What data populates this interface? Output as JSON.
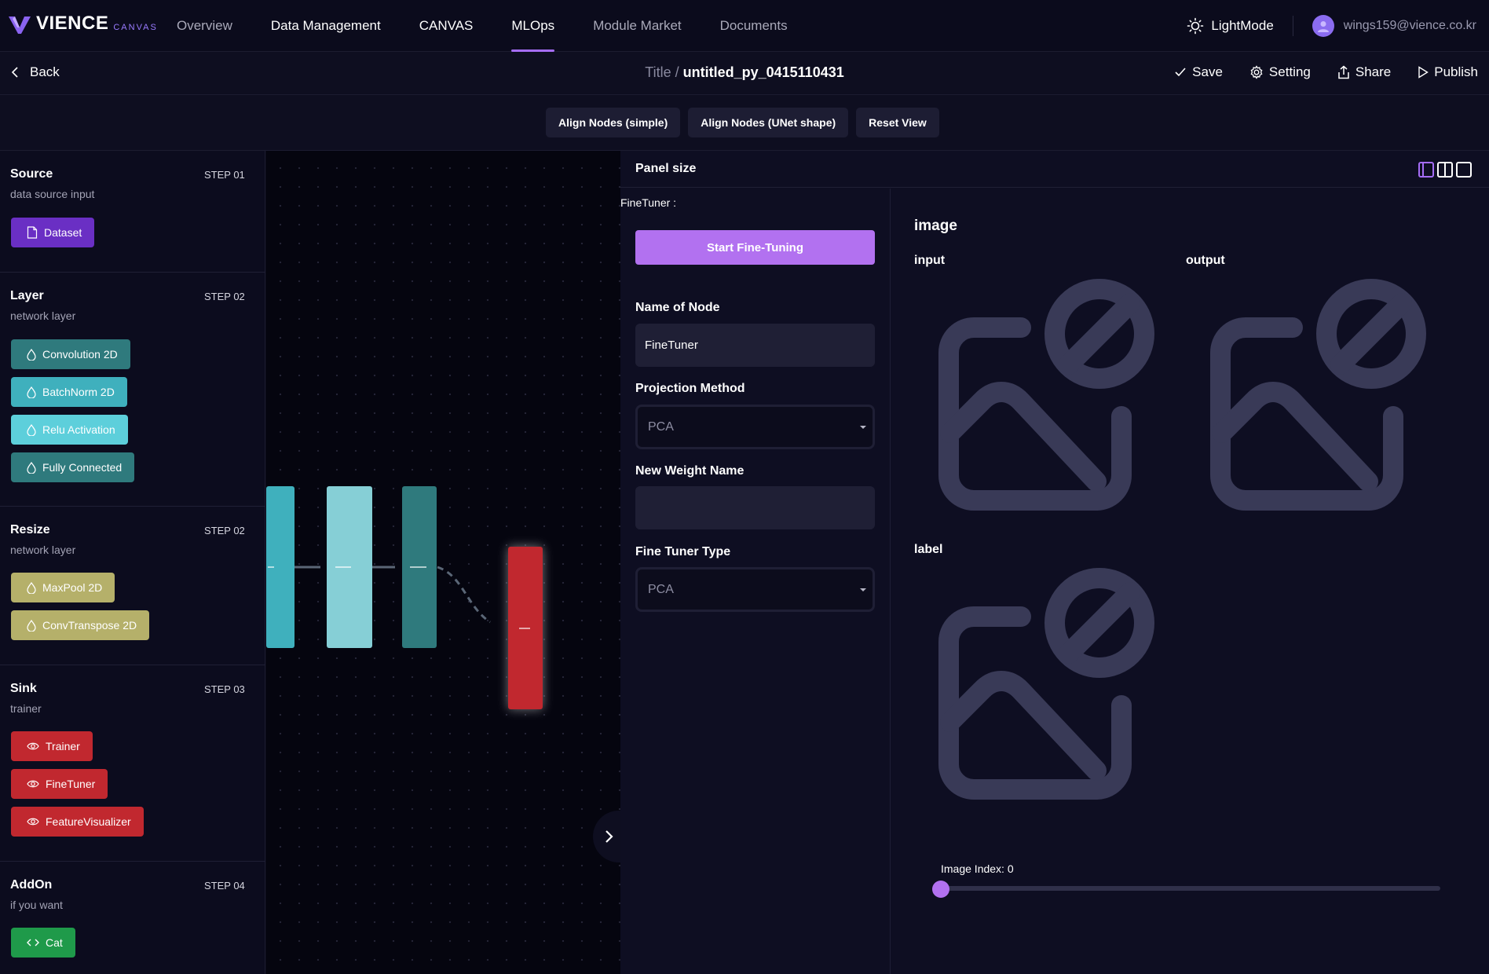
{
  "brand": {
    "name": "VIENCE",
    "sub": "CANVAS"
  },
  "nav": {
    "tabs": [
      "Overview",
      "Data Management",
      "CANVAS",
      "MLOps",
      "Module Market",
      "Documents"
    ],
    "active": "MLOps",
    "lightmode": "LightMode",
    "user_email": "wings159@vience.co.kr"
  },
  "titlebar": {
    "back": "Back",
    "title_prefix": "Title /",
    "title": "untitled_py_0415110431",
    "actions": {
      "save": "Save",
      "setting": "Setting",
      "share": "Share",
      "publish": "Publish"
    }
  },
  "toolbar": {
    "align_simple": "Align Nodes (simple)",
    "align_unet": "Align Nodes (UNet shape)",
    "reset_view": "Reset View"
  },
  "sidebar": {
    "sections": [
      {
        "title": "Source",
        "step": "STEP 01",
        "sub": "data source input",
        "items": [
          {
            "label": "Dataset",
            "icon": "file-icon",
            "color": "#6a2fc4"
          }
        ]
      },
      {
        "title": "Layer",
        "step": "STEP 02",
        "sub": "network layer",
        "items": [
          {
            "label": "Convolution 2D",
            "icon": "drop-icon",
            "color": "#2f7a7d"
          },
          {
            "label": "BatchNorm 2D",
            "icon": "drop-icon",
            "color": "#3fb0bd"
          },
          {
            "label": "Relu Activation",
            "icon": "drop-icon",
            "color": "#5dcfdb"
          },
          {
            "label": "Fully Connected",
            "icon": "drop-icon",
            "color": "#2f7a7d"
          }
        ]
      },
      {
        "title": "Resize",
        "step": "STEP 02",
        "sub": "network layer",
        "items": [
          {
            "label": "MaxPool 2D",
            "icon": "drop-icon",
            "color": "#b5b06a"
          },
          {
            "label": "ConvTranspose 2D",
            "icon": "drop-icon",
            "color": "#b5b06a"
          }
        ]
      },
      {
        "title": "Sink",
        "step": "STEP 03",
        "sub": "trainer",
        "items": [
          {
            "label": "Trainer",
            "icon": "eye-icon",
            "color": "#c1282f"
          },
          {
            "label": "FineTuner",
            "icon": "eye-icon",
            "color": "#c1282f"
          },
          {
            "label": "FeatureVisualizer",
            "icon": "eye-icon",
            "color": "#c1282f"
          }
        ]
      },
      {
        "title": "AddOn",
        "step": "STEP 04",
        "sub": "if you want",
        "items": [
          {
            "label": "Cat",
            "icon": "code-icon",
            "color": "#1f9a4a"
          }
        ]
      }
    ]
  },
  "panel": {
    "title": "Panel size",
    "finetuner_label": "FineTuner :",
    "start_button": "Start Fine-Tuning",
    "fields": {
      "name_label": "Name of Node",
      "name_value": "FineTuner",
      "projection_label": "Projection Method",
      "projection_value": "PCA",
      "weight_label": "New Weight Name",
      "weight_value": "",
      "type_label": "Fine Tuner Type",
      "type_value": "PCA"
    },
    "image": {
      "heading": "image",
      "input": "input",
      "output": "output",
      "label": "label"
    },
    "slider": {
      "label": "Image Index: 0",
      "value": 0
    }
  }
}
